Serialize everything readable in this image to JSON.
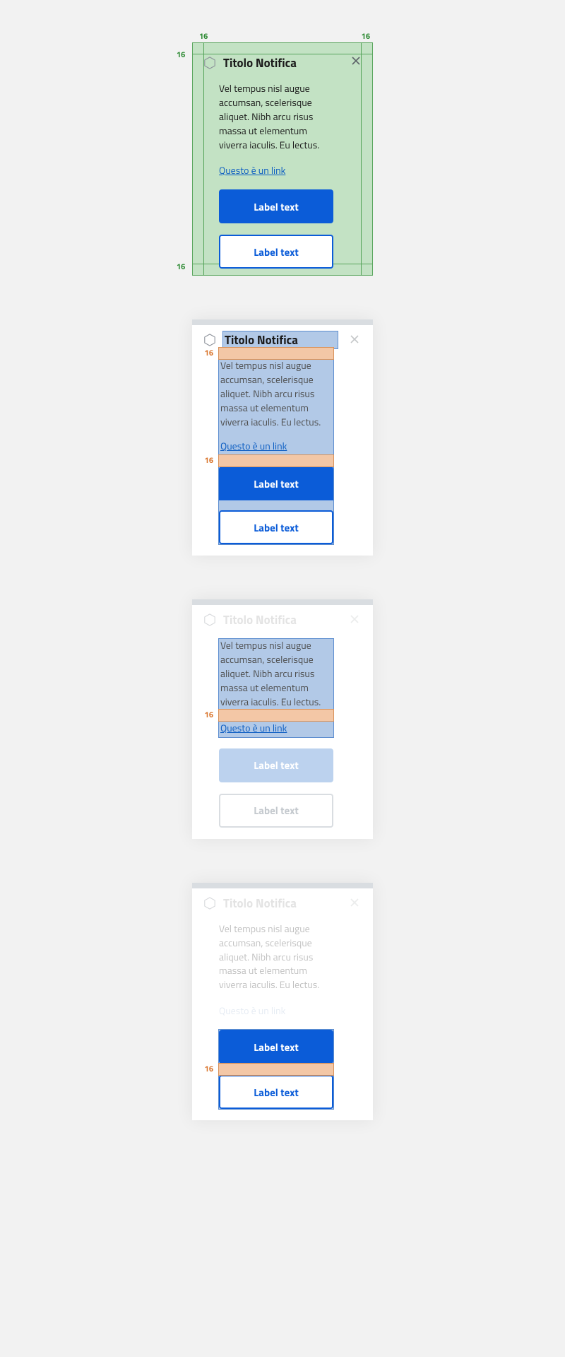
{
  "spacing": {
    "pad": "16"
  },
  "card": {
    "title": "Titolo Notifica",
    "description": "Vel tempus nisl augue accumsan, scelerisque aliquet. Nibh arcu risus massa ut elementum viverra iaculis. Eu lectus.",
    "link": "Questo è un link",
    "primary_label": "Label text",
    "secondary_label": "Label text"
  }
}
